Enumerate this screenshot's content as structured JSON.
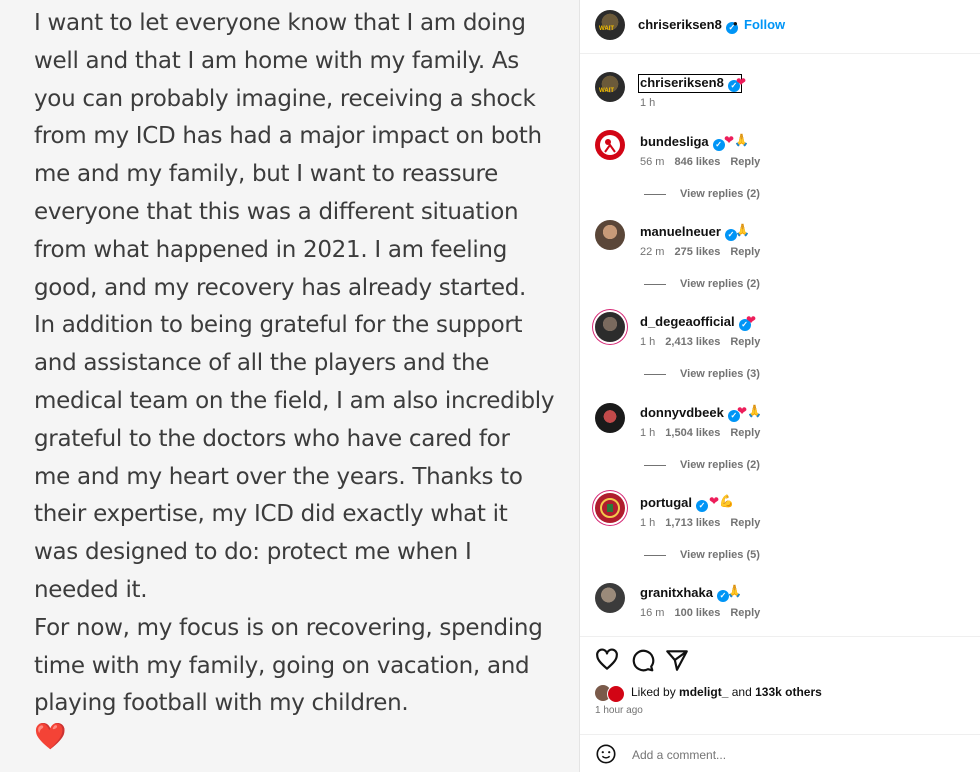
{
  "post": {
    "caption": "I want to let everyone know that I am doing\nwell and that I am home with my family. As\nyou can probably imagine, receiving a shock\nfrom my ICD has had a major impact on both\nme and my family, but I want to reassure\neveryone that this was a different situation\nfrom what happened in 2021. I am feeling\ngood, and my recovery has already started.\nIn addition to being grateful for the support\nand assistance of all the players and the\nmedical team on the field, I am also incredibly\ngrateful to the doctors who have cared for\nme and my heart over the years. Thanks to\ntheir expertise, my ICD did exactly what it\nwas designed to do: protect me when I\nneeded it.\nFor now, my focus is on recovering, spending\ntime with my family, going on vacation, and\nplaying football with my children.",
    "heart_emoji": "❤️"
  },
  "header": {
    "username": "chriseriksen8",
    "separator": "•",
    "follow_label": "Follow"
  },
  "owner_comment": {
    "username": "chriseriksen8",
    "emoji": "❤",
    "time": "1 h"
  },
  "comments": [
    {
      "username": "bundesliga",
      "emoji": "❤🙏",
      "time": "56 m",
      "likes": "846 likes",
      "reply": "Reply",
      "view_replies": "View replies (2)"
    },
    {
      "username": "manuelneuer",
      "emoji": "🙏",
      "time": "22 m",
      "likes": "275 likes",
      "reply": "Reply",
      "view_replies": "View replies (2)"
    },
    {
      "username": "d_degeaofficial",
      "emoji": "❤",
      "time": "1 h",
      "likes": "2,413 likes",
      "reply": "Reply",
      "view_replies": "View replies (3)"
    },
    {
      "username": "donnyvdbeek",
      "emoji": "❤🙏",
      "time": "1 h",
      "likes": "1,504 likes",
      "reply": "Reply",
      "view_replies": "View replies (2)"
    },
    {
      "username": "portugal",
      "emoji": "❤💪",
      "time": "1 h",
      "likes": "1,713 likes",
      "reply": "Reply",
      "view_replies": "View replies (5)"
    },
    {
      "username": "granitxhaka",
      "emoji": "🙏",
      "time": "16 m",
      "likes": "100 likes",
      "reply": "Reply",
      "view_replies": ""
    }
  ],
  "actions": {
    "liked_prefix": "Liked by",
    "liked_user": "mdeligt_",
    "liked_and": "and",
    "liked_others": "133k others",
    "time": "1 hour ago"
  },
  "comment_box": {
    "placeholder": "Add a comment..."
  },
  "colors": {
    "accent": "#0095f6",
    "heart": "#ed1d5a"
  }
}
